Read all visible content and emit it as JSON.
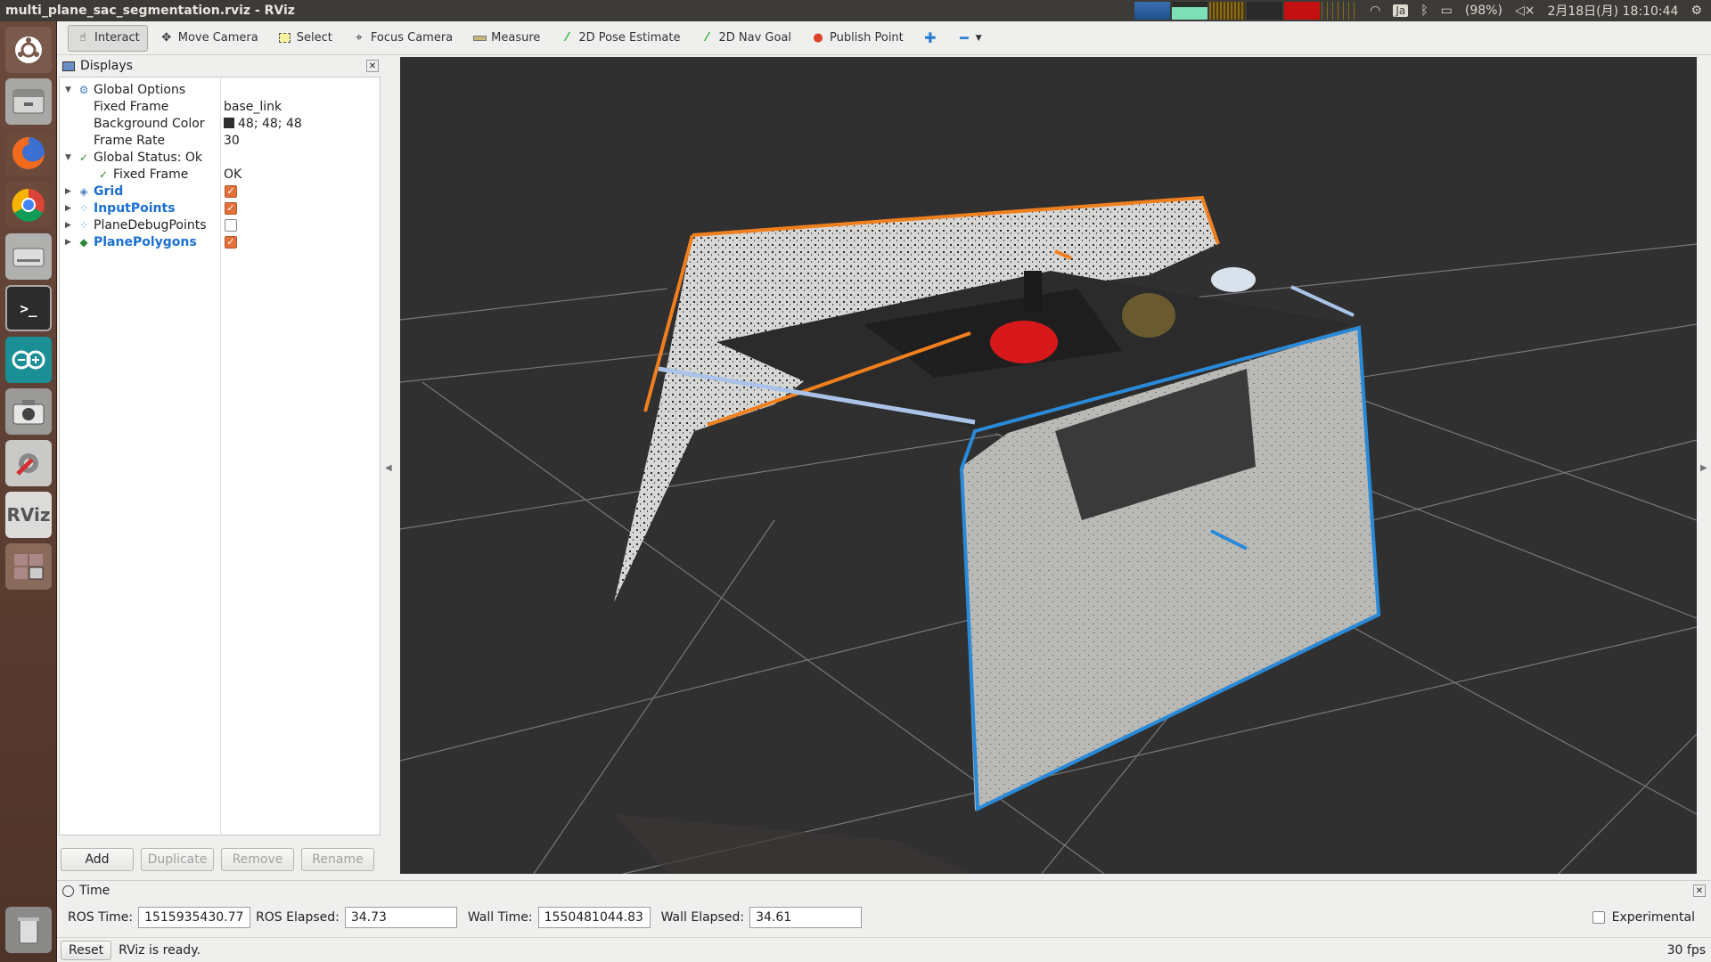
{
  "window": {
    "title": "multi_plane_sac_segmentation.rviz - RViz"
  },
  "system": {
    "lang": "Ja",
    "battery": "(98%)",
    "datetime": "2月18日(月) 18:10:44"
  },
  "toolbar": {
    "interact": "Interact",
    "move_camera": "Move Camera",
    "select": "Select",
    "focus_camera": "Focus Camera",
    "measure": "Measure",
    "pose_estimate": "2D Pose Estimate",
    "nav_goal": "2D Nav Goal",
    "publish_point": "Publish Point"
  },
  "displays": {
    "title": "Displays",
    "global_options": "Global Options",
    "fixed_frame_label": "Fixed Frame",
    "fixed_frame_value": "base_link",
    "bg_color_label": "Background Color",
    "bg_color_value": "48; 48; 48",
    "frame_rate_label": "Frame Rate",
    "frame_rate_value": "30",
    "global_status": "Global Status: Ok",
    "status_fixed_frame": "Fixed Frame",
    "status_fixed_frame_value": "OK",
    "items": [
      {
        "label": "Grid",
        "checked": true
      },
      {
        "label": "InputPoints",
        "checked": true
      },
      {
        "label": "PlaneDebugPoints",
        "checked": false
      },
      {
        "label": "PlanePolygons",
        "checked": true
      }
    ],
    "buttons": {
      "add": "Add",
      "duplicate": "Duplicate",
      "remove": "Remove",
      "rename": "Rename"
    }
  },
  "time": {
    "title": "Time",
    "ros_time_label": "ROS Time:",
    "ros_time": "1515935430.77",
    "ros_elapsed_label": "ROS Elapsed:",
    "ros_elapsed": "34.73",
    "wall_time_label": "Wall Time:",
    "wall_time": "1550481044.83",
    "wall_elapsed_label": "Wall Elapsed:",
    "wall_elapsed": "34.61",
    "experimental": "Experimental"
  },
  "status": {
    "reset": "Reset",
    "message": "RViz is ready.",
    "fps": "30 fps"
  },
  "colors": {
    "viewport_bg": "#303030",
    "plane_orange": "#f07f1e",
    "plane_blue": "#2a8ad8",
    "accent_blue": "#1a6fd0"
  }
}
